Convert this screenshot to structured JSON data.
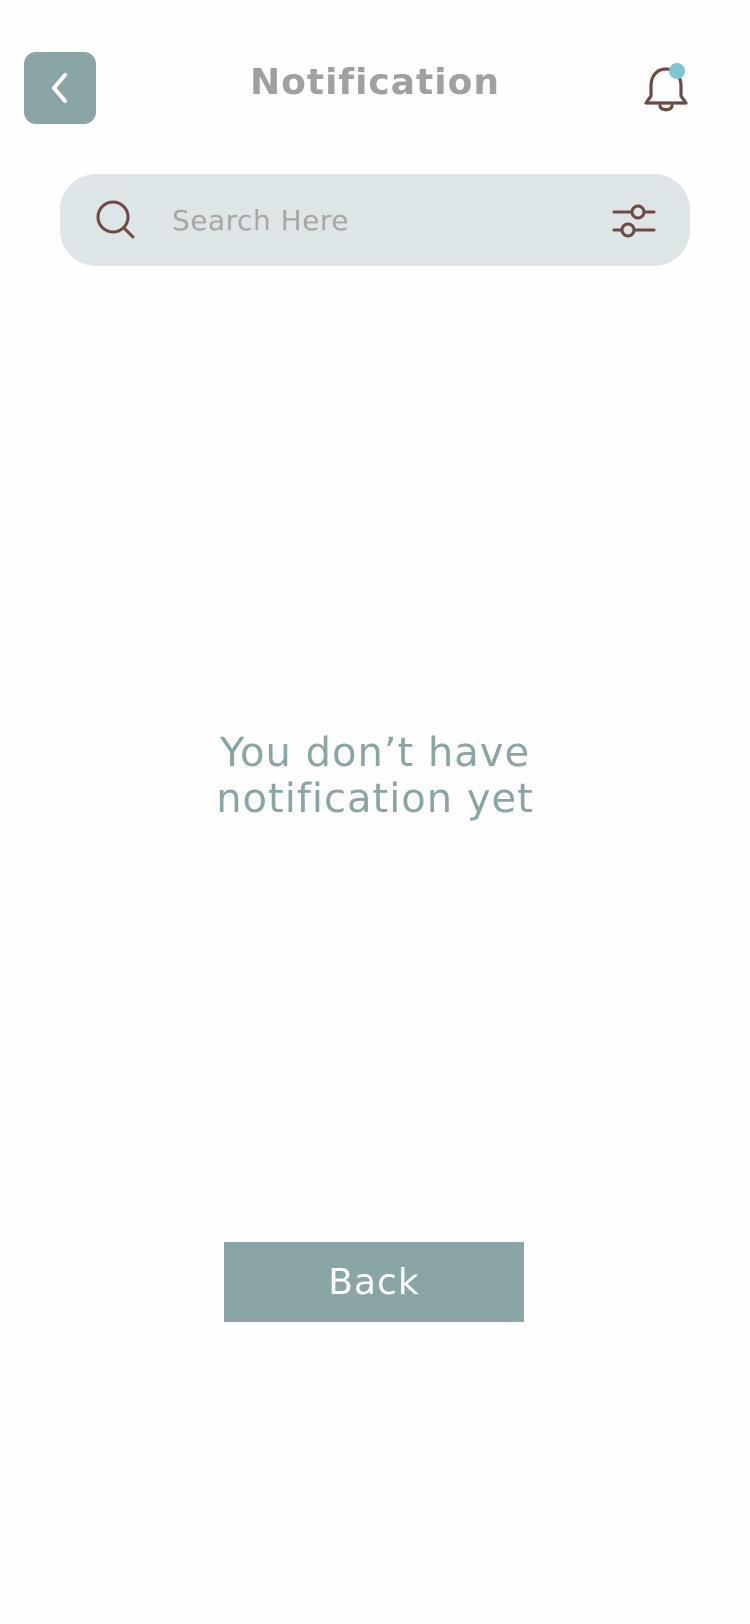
{
  "header": {
    "title": "Notification",
    "back_icon": "chevron-left-icon",
    "bell_icon": "bell-icon",
    "bell_badge_color": "#7cc7cf"
  },
  "search": {
    "placeholder": "Search Here",
    "value": "",
    "search_icon": "search-icon",
    "filter_icon": "sliders-icon"
  },
  "empty_state": {
    "line1": "You don’t have",
    "line2": "notification yet"
  },
  "actions": {
    "back_label": "Back"
  },
  "colors": {
    "accent": "#89a5a6",
    "search_bg": "#dde5e6",
    "icon_brown": "#6e4a46",
    "title_gray": "#a0a0a2"
  }
}
